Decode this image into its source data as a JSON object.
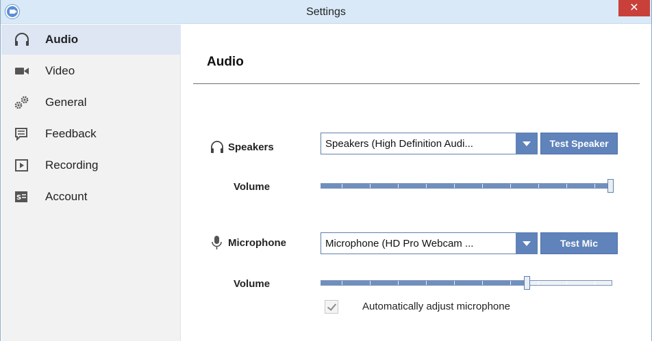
{
  "window": {
    "title": "Settings",
    "close_glyph": "✕",
    "app_icon": "camera-icon"
  },
  "sidebar": {
    "items": [
      {
        "label": "Audio",
        "icon": "headphones-icon",
        "active": true
      },
      {
        "label": "Video",
        "icon": "video-camera-icon",
        "active": false
      },
      {
        "label": "General",
        "icon": "gears-icon",
        "active": false
      },
      {
        "label": "Feedback",
        "icon": "chat-bubble-icon",
        "active": false
      },
      {
        "label": "Recording",
        "icon": "play-icon",
        "active": false
      },
      {
        "label": "Account",
        "icon": "account-card-icon",
        "active": false
      }
    ]
  },
  "main": {
    "title": "Audio",
    "speakers": {
      "label": "Speakers",
      "icon": "headphones-icon",
      "selected": "Speakers (High Definition Audi...",
      "test_button": "Test Speaker",
      "volume_label": "Volume",
      "volume_level": 1.0
    },
    "microphone": {
      "label": "Microphone",
      "icon": "microphone-icon",
      "selected": "Microphone (HD Pro Webcam ...",
      "test_button": "Test Mic",
      "volume_label": "Volume",
      "volume_level": 0.71
    },
    "auto_adjust": {
      "label": "Automatically adjust microphone",
      "checked": true
    }
  },
  "colors": {
    "accent": "#5f83ba",
    "titlebar": "#d9e9f8",
    "sidebar_bg": "#f2f2f2",
    "sidebar_active": "#dde6f2",
    "close": "#c9403a"
  }
}
